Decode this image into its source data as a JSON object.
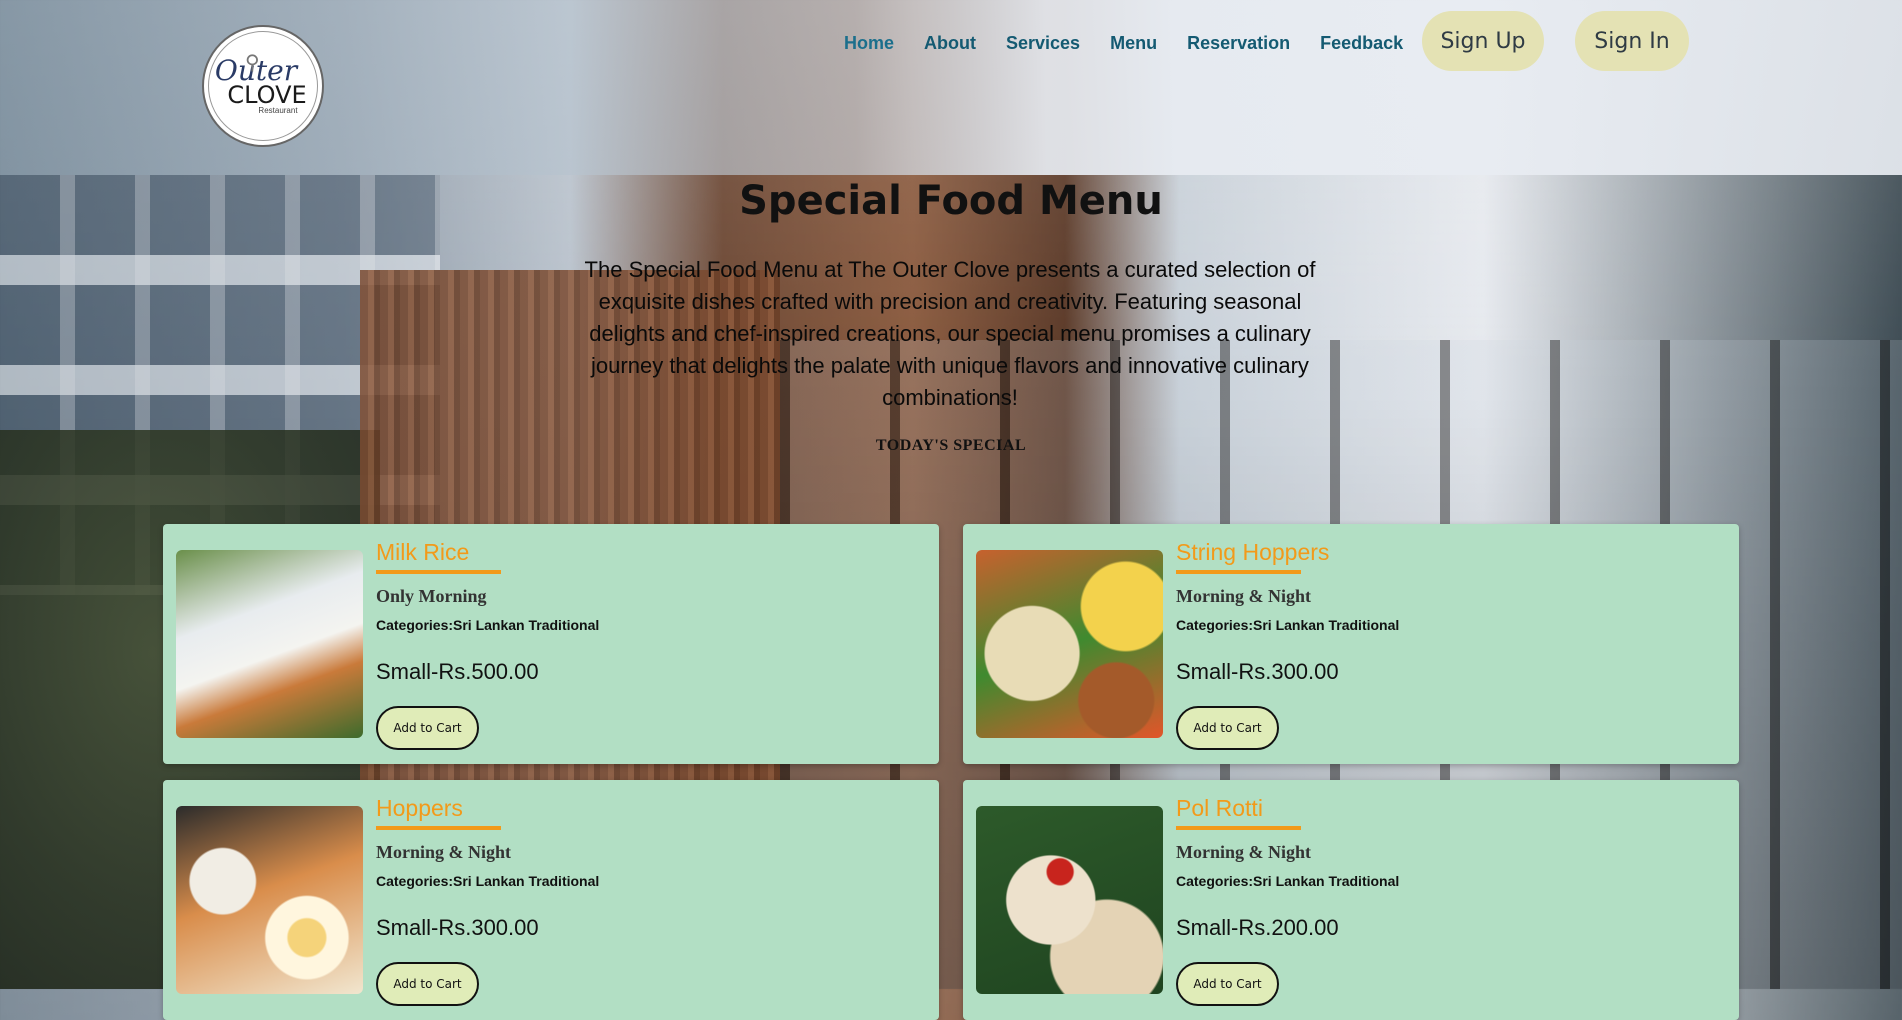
{
  "brand": {
    "logo_line1": "Outer",
    "logo_line2": "CLOVE",
    "logo_line3": "Restaurant"
  },
  "nav": {
    "items": [
      "Home",
      "About",
      "Services",
      "Menu",
      "Reservation",
      "Feedback"
    ],
    "active": "Home",
    "sign_up": "Sign Up",
    "sign_in": "Sign In"
  },
  "hero": {
    "title": "Special Food Menu",
    "description": "The Special Food Menu at The Outer Clove presents a curated selection of exquisite dishes crafted with precision and creativity. Featuring seasonal delights and chef-inspired creations, our special menu promises a culinary journey that delights the palate with unique flavors and innovative culinary combinations!",
    "section_label": "TODAY'S SPECIAL"
  },
  "menu_items": [
    {
      "name": "Milk Rice",
      "time": "Only Morning",
      "category": "Categories:Sri Lankan Traditional",
      "price": "Small-Rs.500.00",
      "button": "Add to Cart",
      "image": "milk-rice-photo"
    },
    {
      "name": "String Hoppers",
      "time": "Morning & Night",
      "category": "Categories:Sri Lankan Traditional",
      "price": "Small-Rs.300.00",
      "button": "Add to Cart",
      "image": "string-hoppers-photo"
    },
    {
      "name": "Hoppers",
      "time": "Morning & Night",
      "category": "Categories:Sri Lankan Traditional",
      "price": "Small-Rs.300.00",
      "button": "Add to Cart",
      "image": "hoppers-photo"
    },
    {
      "name": "Pol Rotti",
      "time": "Morning & Night",
      "category": "Categories:Sri Lankan Traditional",
      "price": "Small-Rs.200.00",
      "button": "Add to Cart",
      "image": "pol-rotti-photo"
    }
  ],
  "colors": {
    "card_bg": "#b2dfc4",
    "title_accent": "#f29a1a",
    "nav_link": "#145a72",
    "pill_bg": "#e4e2b4",
    "cart_btn_bg": "#e0ecb8"
  }
}
